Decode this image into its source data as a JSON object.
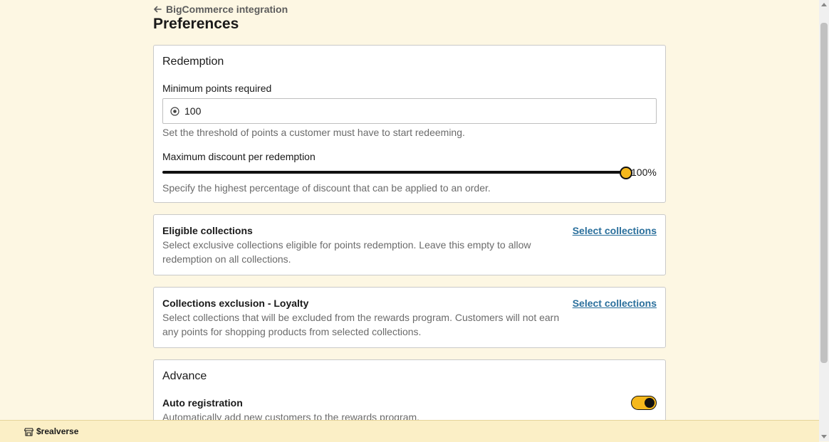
{
  "header": {
    "back_label": "BigCommerce integration",
    "title": "Preferences"
  },
  "redemption": {
    "section_title": "Redemption",
    "min_points_label": "Minimum points required",
    "min_points_value": "100",
    "min_points_help": "Set the threshold of points a customer must have to start redeeming.",
    "max_discount_label": "Maximum discount per redemption",
    "max_discount_percent": 100,
    "max_discount_value_text": "100%",
    "max_discount_help": "Specify the highest percentage of discount that can be applied to an order."
  },
  "eligible": {
    "title": "Eligible collections",
    "link": "Select collections",
    "description": "Select exclusive collections eligible for points redemption. Leave this empty to allow redemption on all collections."
  },
  "exclusion": {
    "title": "Collections exclusion - Loyalty",
    "link": "Select collections",
    "description": "Select collections that will be excluded from the rewards program. Customers will not earn any points for shopping products from selected collections."
  },
  "advance": {
    "section_title": "Advance",
    "auto_registration_label": "Auto registration",
    "auto_registration_help": "Automatically add new customers to the rewards program.",
    "auto_registration_enabled": true
  },
  "footer": {
    "brand": "$realverse"
  },
  "colors": {
    "accent": "#f5b81c",
    "link": "#2a6f9c",
    "background": "#fdf7e3"
  }
}
